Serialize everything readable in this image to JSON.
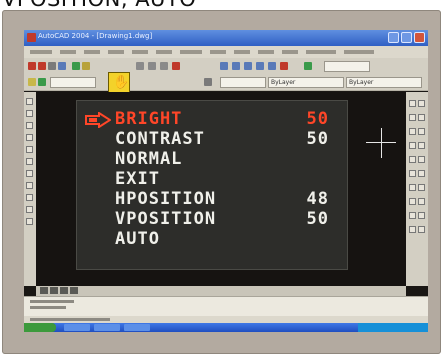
{
  "caption": "VPOSITION, AUTO",
  "window": {
    "title": "AutoCAD 2004 - [Drawing1.dwg]"
  },
  "osd": {
    "items": [
      {
        "label": "BRIGHT",
        "value": "50",
        "selected": true
      },
      {
        "label": "CONTRAST",
        "value": "50",
        "selected": false
      },
      {
        "label": "NORMAL",
        "value": "",
        "selected": false
      },
      {
        "label": "EXIT",
        "value": "",
        "selected": false
      },
      {
        "label": "HPOSITION",
        "value": "48",
        "selected": false
      },
      {
        "label": "VPOSITION",
        "value": "50",
        "selected": false
      },
      {
        "label": "AUTO",
        "value": "",
        "selected": false
      }
    ]
  },
  "toolbar": {
    "layer_value": "ByLayer"
  },
  "colors": {
    "selected_item": "#ff4628",
    "osd_text": "#f0f0ea",
    "osd_background": "#2d2d2a",
    "bezel": "#b3aaa0"
  },
  "icons": [
    "hand-pointer-icon",
    "hand-tool-icon",
    "close-icon",
    "maximize-icon",
    "minimize-icon"
  ]
}
